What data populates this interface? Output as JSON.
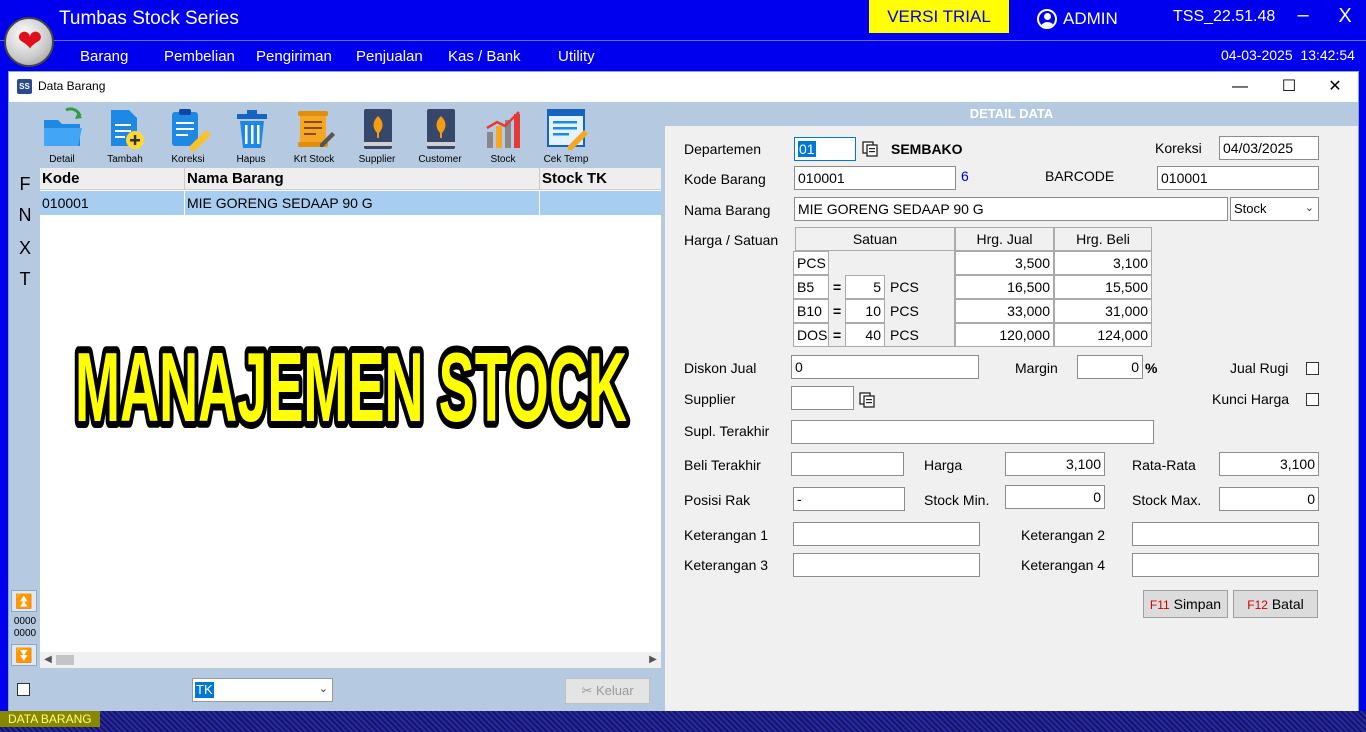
{
  "app": {
    "title": "Tumbas Stock Series",
    "trial_badge": "VERSI TRIAL",
    "user": "ADMIN",
    "version": "TSS_22.51.48",
    "minimize": "–",
    "close": "X",
    "date": "04-03-2025",
    "time": "13:42:54"
  },
  "menu": [
    "Barang",
    "Pembelian",
    "Pengiriman",
    "Penjualan",
    "Kas / Bank",
    "Utility"
  ],
  "window": {
    "title": "Data Barang",
    "icon_text": "SS",
    "min": "—",
    "max": "☐",
    "close": "✕"
  },
  "toolbar": [
    "Detail",
    "Tambah",
    "Koreksi",
    "Hapus",
    "Krt Stock",
    "Supplier",
    "Customer",
    "Stock",
    "Cek Temp"
  ],
  "side_letters": [
    "F",
    "N",
    "X",
    "T"
  ],
  "grid": {
    "columns": [
      "Kode",
      "Nama Barang",
      "Stock TK"
    ],
    "rows": [
      {
        "kode": "010001",
        "nama": "MIE GORENG SEDAAP 90 G",
        "stock": ""
      }
    ]
  },
  "banner_text": "MANAJEMEN STOCK",
  "counter": [
    "0000",
    "0000"
  ],
  "store_combo": "TK",
  "keluar_label": "Keluar",
  "detail": {
    "header": "DETAIL DATA",
    "departemen_label": "Departemen",
    "departemen_code": "01",
    "departemen_name": "SEMBAKO",
    "koreksi_label": "Koreksi",
    "koreksi_date": "04/03/2025",
    "kode_label": "Kode Barang",
    "kode_value": "010001",
    "kode_len": "6",
    "barcode_label": "BARCODE",
    "barcode_value": "010001",
    "nama_label": "Nama Barang",
    "nama_value": "MIE GORENG SEDAAP 90 G",
    "jenis_value": "Stock",
    "harga_satuan_label": "Harga / Satuan",
    "price_table": {
      "satuan_header": "Satuan",
      "jual_header": "Hrg. Jual",
      "beli_header": "Hrg. Beli",
      "eq": "=",
      "rows": [
        {
          "unit": "PCS",
          "qty": "",
          "base": "",
          "jual": "3,500",
          "beli": "3,100"
        },
        {
          "unit": "B5",
          "qty": "5",
          "base": "PCS",
          "jual": "16,500",
          "beli": "15,500"
        },
        {
          "unit": "B10",
          "qty": "10",
          "base": "PCS",
          "jual": "33,000",
          "beli": "31,000"
        },
        {
          "unit": "DOS",
          "qty": "40",
          "base": "PCS",
          "jual": "120,000",
          "beli": "124,000"
        }
      ]
    },
    "diskon_label": "Diskon Jual",
    "diskon_value": "0",
    "margin_label": "Margin",
    "margin_value": "0",
    "margin_unit": "%",
    "jual_rugi_label": "Jual Rugi",
    "supplier_label": "Supplier",
    "supplier_value": "",
    "kunci_harga_label": "Kunci Harga",
    "supl_terakhir_label": "Supl. Terakhir",
    "supl_terakhir_value": "",
    "beli_terakhir_label": "Beli Terakhir",
    "beli_terakhir_value": "",
    "harga_label": "Harga",
    "harga_value": "3,100",
    "rata_label": "Rata-Rata",
    "rata_value": "3,100",
    "posisi_label": "Posisi Rak",
    "posisi_value": "-",
    "stock_min_label": "Stock Min.",
    "stock_min_value": "0",
    "stock_max_label": "Stock Max.",
    "stock_max_value": "0",
    "ket1_label": "Keterangan 1",
    "ket2_label": "Keterangan 2",
    "ket3_label": "Keterangan 3",
    "ket4_label": "Keterangan 4",
    "simpan_key": "F11",
    "simpan_label": "Simpan",
    "batal_key": "F12",
    "batal_label": "Batal"
  },
  "status": "DATA BARANG",
  "colors": {
    "app_blue": "#0000ee",
    "trial_yellow": "#ffff00",
    "panel_blue": "#b5cae0",
    "row_selected": "#a7cdf0",
    "banner_yellow": "#ffff00"
  }
}
